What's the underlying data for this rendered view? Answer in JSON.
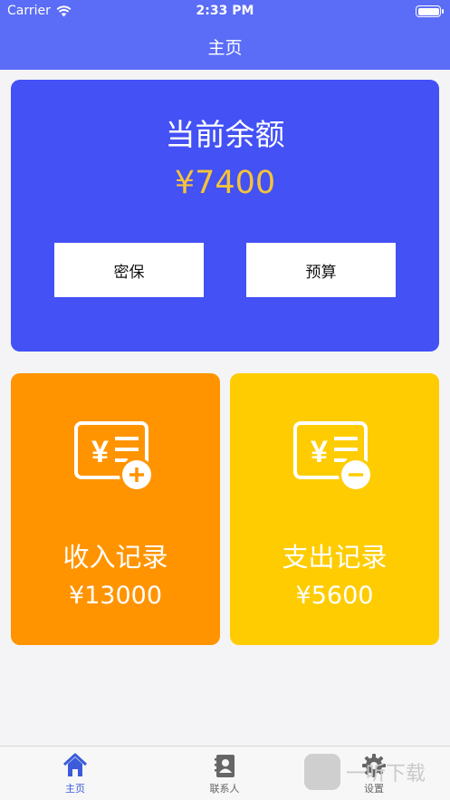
{
  "status_bar": {
    "carrier": "Carrier",
    "time": "2:33 PM"
  },
  "header": {
    "title": "主页"
  },
  "balance": {
    "label": "当前余额",
    "amount": "¥7400",
    "amount_color": "#f5c33b"
  },
  "buttons": {
    "security": "密保",
    "budget": "预算"
  },
  "income": {
    "label": "收入记录",
    "amount": "¥13000",
    "color": "#ff9400",
    "icon": "income-receipt-plus-icon"
  },
  "expense": {
    "label": "支出记录",
    "amount": "¥5600",
    "color": "#fecc00",
    "icon": "expense-receipt-minus-icon"
  },
  "tabs": [
    {
      "label": "主页",
      "icon": "home-icon",
      "active": true
    },
    {
      "label": "联系人",
      "icon": "contacts-icon",
      "active": false
    },
    {
      "label": "设置",
      "icon": "gear-icon",
      "active": false
    }
  ],
  "watermark": {
    "text": "一听下载"
  }
}
